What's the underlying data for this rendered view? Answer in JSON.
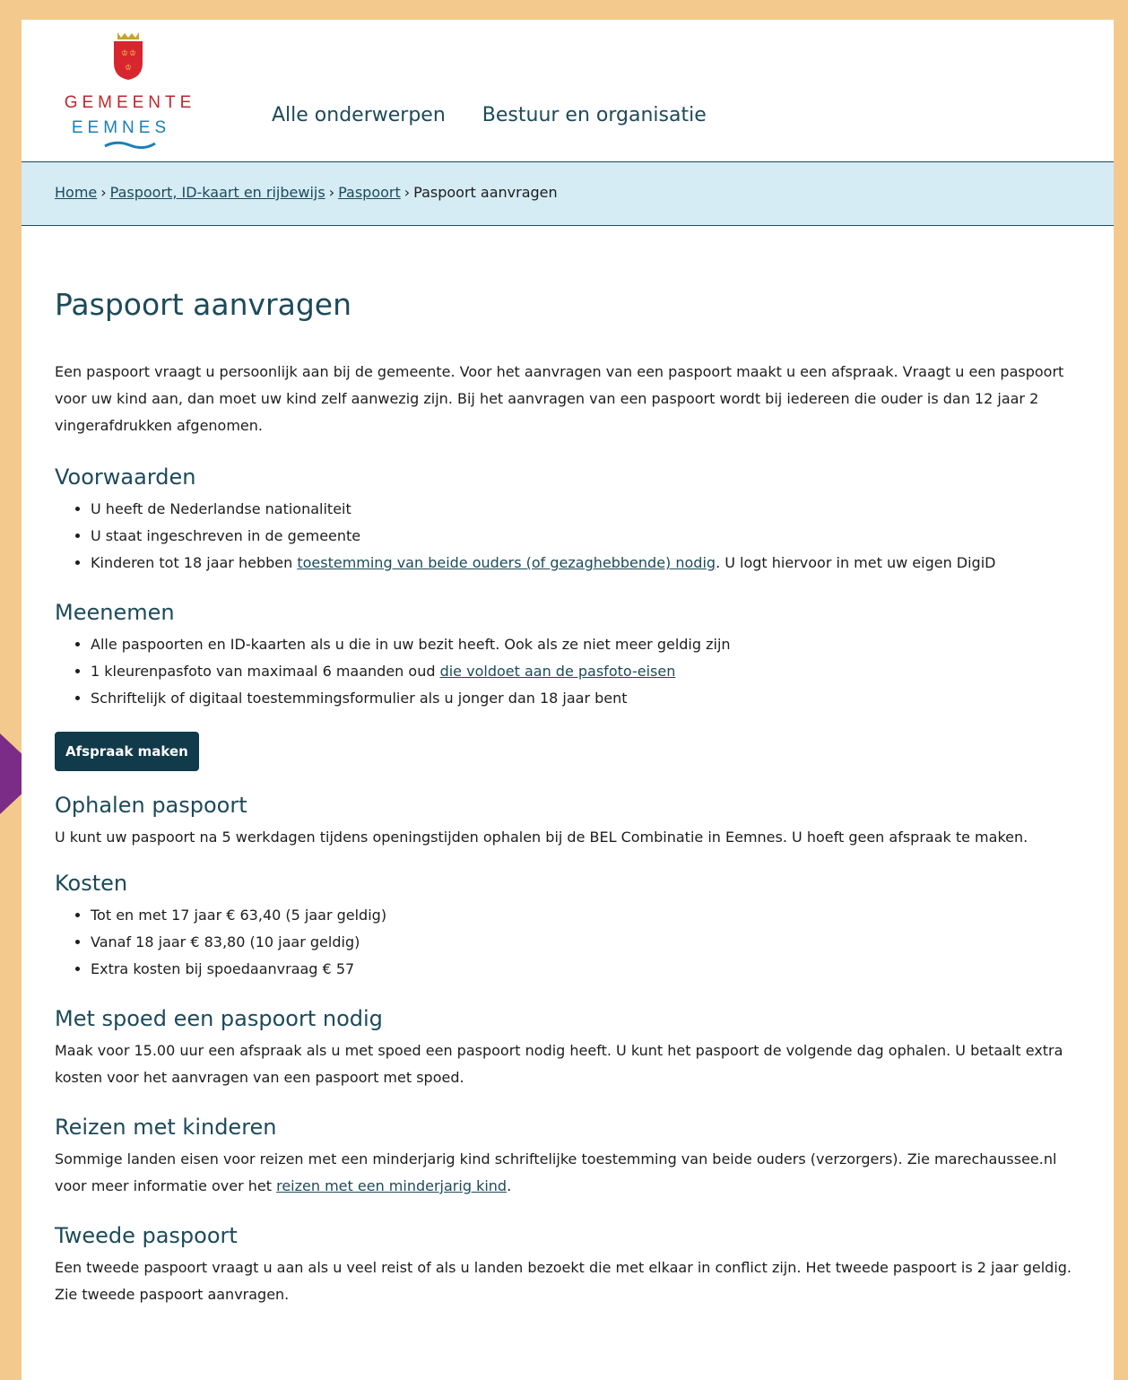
{
  "header": {
    "logo_line1": "GEMEENTE",
    "logo_line2": "EEMNES",
    "nav": [
      "Alle onderwerpen",
      "Bestuur en organisatie"
    ]
  },
  "breadcrumb": {
    "items": [
      "Home",
      "Paspoort, ID-kaart en rijbewijs",
      "Paspoort"
    ],
    "separator": "›",
    "current": "Paspoort aanvragen"
  },
  "page": {
    "title": "Paspoort aanvragen",
    "intro": "Een paspoort vraagt u persoonlijk aan bij de gemeente. Voor het aanvragen van een paspoort maakt u een afspraak. Vraagt u een paspoort voor uw kind aan, dan moet uw kind zelf aanwezig zijn. Bij het aanvragen van een paspoort wordt bij iedereen die ouder is dan 12 jaar 2 vingerafdrukken afgenomen."
  },
  "voorwaarden": {
    "heading": "Voorwaarden",
    "item1": "U heeft de Nederlandse nationaliteit",
    "item2": "U staat ingeschreven in de gemeente",
    "item3_pre": "Kinderen tot 18 jaar hebben ",
    "item3_link": "toestemming van beide ouders (of gezaghebbende) nodig",
    "item3_post": ". U logt hiervoor in met uw eigen DigiD"
  },
  "meenemen": {
    "heading": "Meenemen",
    "item1": "Alle paspoorten en ID-kaarten als u die in uw bezit heeft. Ook als ze niet meer geldig zijn",
    "item2_pre": "1 kleurenpasfoto van maximaal 6 maanden oud ",
    "item2_link": "die voldoet aan de pasfoto-eisen",
    "item3": "Schriftelijk of digitaal toestemmingsformulier als u jonger dan 18 jaar bent"
  },
  "cta": {
    "label": "Afspraak maken"
  },
  "ophalen": {
    "heading": "Ophalen paspoort",
    "text": "U kunt uw paspoort na 5 werkdagen tijdens openingstijden ophalen bij de BEL Combinatie in Eemnes. U hoeft geen afspraak te maken."
  },
  "kosten": {
    "heading": "Kosten",
    "items": [
      "Tot en met 17 jaar € 63,40 (5 jaar geldig)",
      "Vanaf 18 jaar € 83,80 (10 jaar geldig)",
      "Extra kosten bij spoedaanvraag € 57"
    ]
  },
  "spoed": {
    "heading": "Met spoed een paspoort nodig",
    "text": "Maak voor 15.00 uur een afspraak als u met spoed een paspoort nodig heeft. U kunt het paspoort de volgende dag ophalen. U betaalt extra kosten voor het aanvragen van een paspoort met spoed."
  },
  "kinderen": {
    "heading": "Reizen met kinderen",
    "text_pre": "Sommige landen eisen voor reizen met een minderjarig kind schriftelijke toestemming van beide ouders (verzorgers). Zie marechaussee.nl voor meer informatie over het ",
    "link": "reizen met een minderjarig kind",
    "text_post": "."
  },
  "tweede": {
    "heading": "Tweede paspoort",
    "text": "Een tweede paspoort vraagt u aan als u veel reist of als u landen bezoekt die met elkaar in conflict zijn. Het tweede paspoort is 2 jaar geldig. Zie tweede paspoort aanvragen."
  },
  "colors": {
    "frame": "#f4c98e",
    "heading": "#1d4a5a",
    "breadcrumb_bg": "#d5ecf5",
    "button": "#113a4a",
    "arrow": "#7a2c86",
    "logo_red": "#c0262d",
    "logo_blue": "#1a7fb8"
  }
}
